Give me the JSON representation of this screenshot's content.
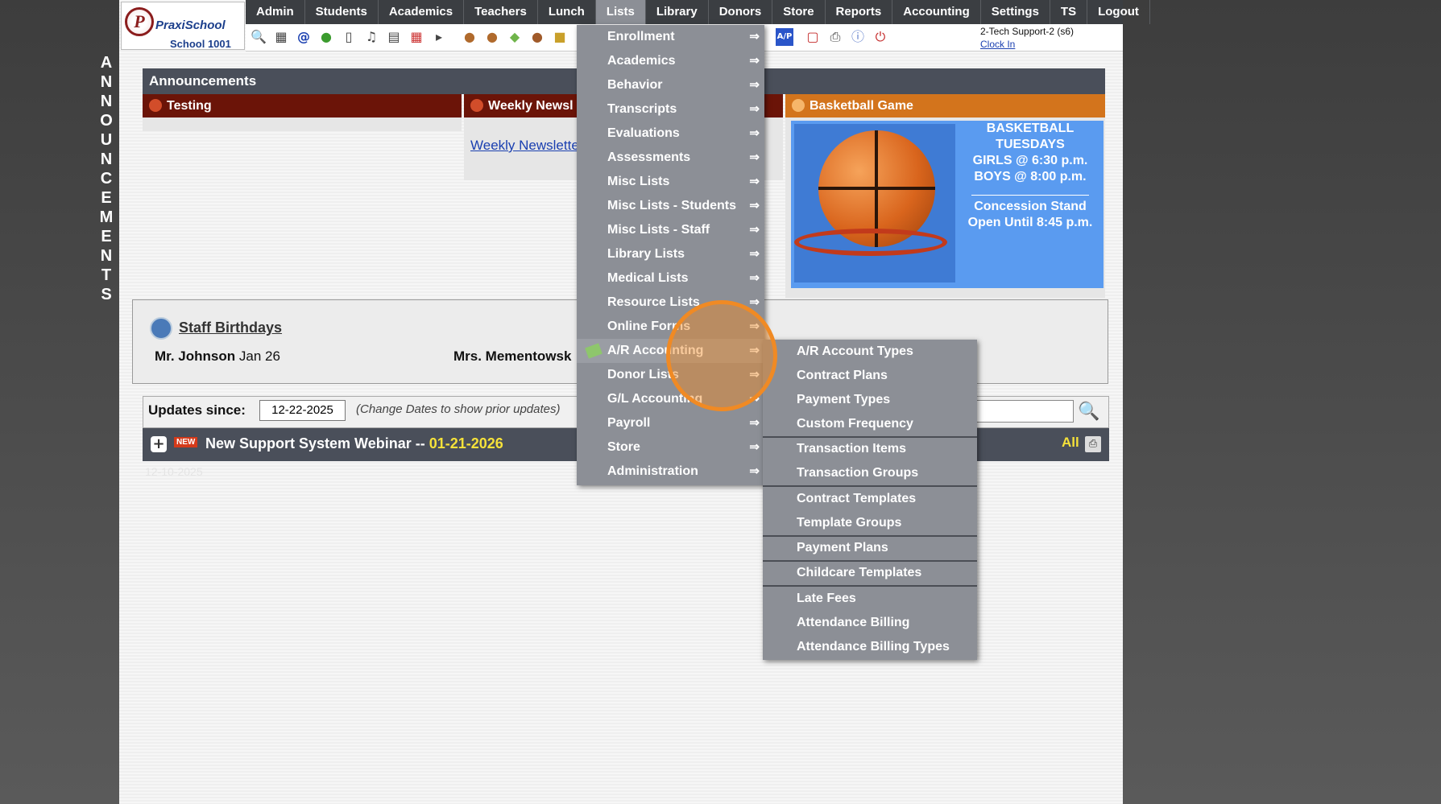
{
  "sidebar_vertical": [
    "A",
    "N",
    "N",
    "O",
    "U",
    "N",
    "C",
    "E",
    "M",
    "E",
    "N",
    "T",
    "S"
  ],
  "logo": {
    "brand": "PraxiSchool",
    "mark": "P",
    "school": "School 1001"
  },
  "nav": [
    "Admin",
    "Students",
    "Academics",
    "Teachers",
    "Lunch",
    "Lists",
    "Library",
    "Donors",
    "Store",
    "Reports",
    "Accounting",
    "Settings",
    "TS",
    "Logout"
  ],
  "nav_active": "Lists",
  "user": {
    "name": "2-Tech Support-2 (s6)",
    "clock": "Clock In"
  },
  "toolbar_icons": [
    "search-icon",
    "calendar-grid-icon",
    "at-icon",
    "chat-icon",
    "phone-icon",
    "speaker-icon",
    "form-icon",
    "calendar-icon",
    "megaphone-icon",
    "person-icon",
    "person-icon",
    "money-icon",
    "people-icon",
    "cake-icon",
    "ap-icon",
    "pdf-icon",
    "print-icon",
    "help-icon",
    "power-icon"
  ],
  "announcements": {
    "header": "Announcements",
    "cards": [
      {
        "title": "Testing",
        "color": "#6b1408"
      },
      {
        "title": "Weekly Newsl",
        "link": "Weekly Newslette",
        "color": "#6b1408"
      },
      {
        "title": "Basketball Game",
        "color": "#d3741c"
      }
    ],
    "basketball": {
      "line1": "BASKETBALL",
      "line2": "TUESDAYS",
      "line3": "GIRLS @ 6:30 p.m.",
      "line4": "BOYS  @ 8:00 p.m.",
      "line5": "Concession Stand",
      "line6": "Open Until 8:45 p.m."
    }
  },
  "birthdays": {
    "title": "Staff Birthdays",
    "entries": [
      {
        "name": "Mr. Johnson",
        "date": "Jan 26"
      },
      {
        "name": "Mrs. Mementowsk",
        "date": ""
      }
    ]
  },
  "updates": {
    "label": "Updates since:",
    "date": "12-22-2025",
    "hint": "(Change Dates to show prior updates)"
  },
  "news": {
    "badge": "NEW",
    "title": "New Support System Webinar -- ",
    "date": "01-21-2026",
    "all": "All",
    "faint": "12-10-2025"
  },
  "lists_menu": [
    "Enrollment",
    "Academics",
    "Behavior",
    "Transcripts",
    "Evaluations",
    "Assessments",
    "Misc Lists",
    "Misc Lists - Students",
    "Misc Lists - Staff",
    "Library Lists",
    "Medical Lists",
    "Resource Lists",
    "Online Forms",
    "A/R Accounting",
    "Donor Lists",
    "G/L Accounting",
    "Payroll",
    "Store",
    "Administration"
  ],
  "lists_menu_active": "A/R Accounting",
  "menu_arrow": "⇒",
  "ar_submenu": [
    "A/R Account Types",
    "Contract Plans",
    "Payment Types",
    "Custom Frequency",
    "Transaction Items",
    "Transaction Groups",
    "Contract Templates",
    "Template Groups",
    "Payment Plans",
    "Childcare Templates",
    "Late Fees",
    "Attendance Billing",
    "Attendance Billing Types"
  ]
}
